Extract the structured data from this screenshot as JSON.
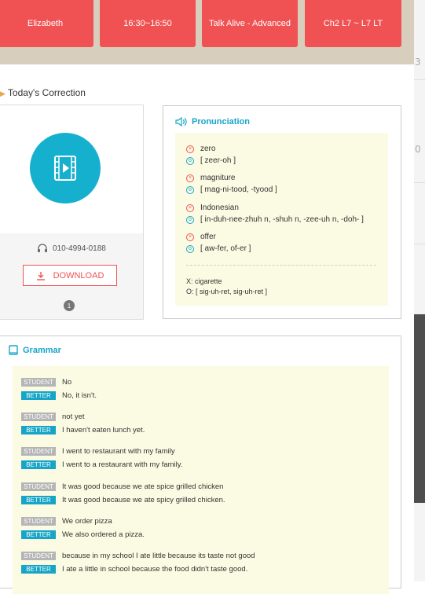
{
  "header": {
    "tutor": "Elizabeth",
    "time": "16:30~16:50",
    "course": "Talk Alive - Advanced",
    "chapter": "Ch2 L7 ~ L7 LT"
  },
  "section_title": "Today's Correction",
  "lesson": {
    "phone": "010-4994-0188",
    "download_label": "DOWNLOAD",
    "page_badge": "1"
  },
  "pronunciation": {
    "title": "Pronunciation",
    "items": [
      {
        "wrong": "zero",
        "right": "[ zeer-oh ]"
      },
      {
        "wrong": "magniture",
        "right": "[ mag-ni-tood, -tyood ]"
      },
      {
        "wrong": "Indonesian",
        "right": "[ in-duh-nee-zhuh n, -shuh n, -zee-uh n, -doh- ]"
      },
      {
        "wrong": "offer",
        "right": "[ aw-fer, of-er ]"
      }
    ],
    "footer_x": "X: cigarette",
    "footer_o": "O: [ sig-uh-ret, sig-uh-ret ]"
  },
  "grammar": {
    "title": "Grammar",
    "student_tag": "STUDENT",
    "better_tag": "BETTER",
    "pairs": [
      {
        "student": "No",
        "better": "No, it isn't."
      },
      {
        "student": "not yet",
        "better": "I haven't eaten lunch yet."
      },
      {
        "student": "I went to restaurant with my family",
        "better": "I went to a restaurant with my family."
      },
      {
        "student": "It was good because we ate spice grilled chicken",
        "better": "It was good because we ate spicy grilled chicken."
      },
      {
        "student": "We order pizza",
        "better": "We also ordered a pizza."
      },
      {
        "student": "because in my school I ate little because its taste not good",
        "better": "I ate a little in school because the food didn't taste good."
      }
    ]
  },
  "colors": {
    "accent_red": "#f05253",
    "accent_cyan": "#16b0cf",
    "highlight_bg": "#fbfbe4"
  }
}
